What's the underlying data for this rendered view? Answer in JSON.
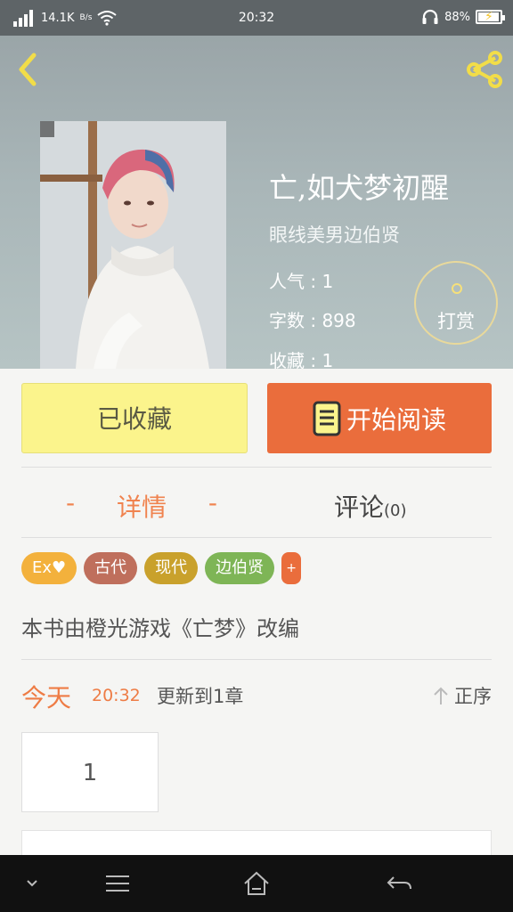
{
  "status_bar": {
    "network_speed": "14.1K",
    "network_unit": "B/s",
    "time": "20:32",
    "battery": "88%",
    "icons": [
      "signal-icon",
      "wifi-icon",
      "headphones-icon",
      "battery-charging-icon"
    ]
  },
  "book": {
    "title": "亡,如犬梦初醒",
    "author": "眼线美男边伯贤",
    "popularity_label": "人气 : 1",
    "word_count_label": "字数 : 898",
    "favorites_label": "收藏 : 1"
  },
  "tip_button": {
    "label": "打赏"
  },
  "actions": {
    "favorited_label": "已收藏",
    "read_label": "开始阅读"
  },
  "tabs": {
    "details_label": "详情",
    "details_dash": "-",
    "comments_label": "评论",
    "comments_count": "(0)"
  },
  "tags": [
    {
      "label": "Ex♥",
      "color": "#f3b13c"
    },
    {
      "label": "古代",
      "color": "#bf6f5c"
    },
    {
      "label": "现代",
      "color": "#c9a12c"
    },
    {
      "label": "边伯贤",
      "color": "#7eb556"
    }
  ],
  "tag_more": "+",
  "description": "本书由橙光游戏《亡梦》改编",
  "update": {
    "day": "今天",
    "time": "20:32",
    "text": "更新到1章",
    "sort_label": "正序"
  },
  "chapters": [
    {
      "label": "1"
    }
  ],
  "colors": {
    "accent": "#ea6d3c",
    "favorite_bg": "#fbf48c",
    "header_bg": "#a9b6b8"
  }
}
